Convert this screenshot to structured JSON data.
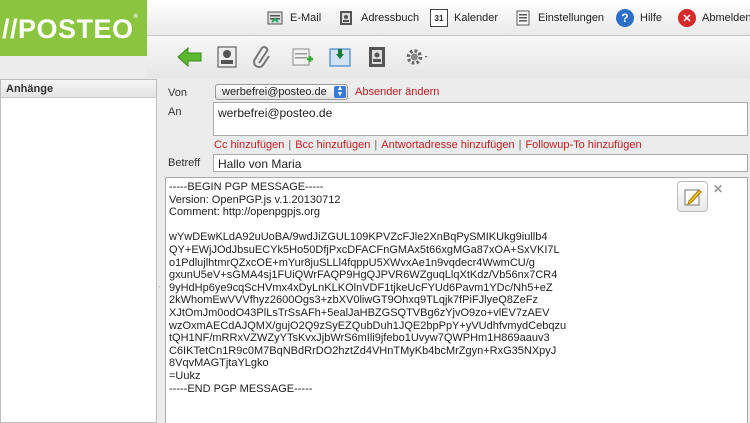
{
  "logo": {
    "text": "//POSTEO",
    "reg": "®"
  },
  "nav": [
    {
      "label": "E-Mail",
      "icon": "email-icon"
    },
    {
      "label": "Adressbuch",
      "icon": "addressbook-icon"
    },
    {
      "label": "Kalender",
      "icon": "calendar-icon",
      "badge": "31"
    },
    {
      "label": "Einstellungen",
      "icon": "settings-icon"
    },
    {
      "label": "Hilfe",
      "icon": "help-icon"
    },
    {
      "label": "Abmelden",
      "icon": "logout-icon"
    }
  ],
  "toolbar": [
    "back-arrow-icon",
    "address-card-icon",
    "paperclip-icon",
    "signature-icon",
    "save-draft-icon",
    "addressbook-icon",
    "gear-icon"
  ],
  "sidebar": {
    "title": "Anhänge"
  },
  "compose": {
    "from_label": "Von",
    "from_value": "werbefrei@posteo.de",
    "change_sender": "Absender ändern",
    "to_label": "An",
    "to_value": "werbefrei@posteo.de",
    "links": [
      "Cc hinzufügen",
      "Bcc hinzufügen",
      "Antwortadresse hinzufügen",
      "Followup-To hinzufügen"
    ],
    "subject_label": "Betreff",
    "subject_value": "Hallo von Maria",
    "body": "-----BEGIN PGP MESSAGE-----\nVersion: OpenPGP.js v.1.20130712\nComment: http://openpgpjs.org\n\nwYwDEwKLdA92uUoBA/9wdJiZGUL109KPVZcFJle2XnBqPySMIKUkg9iullb4\nQY+EWjJOdJbsuECYk5Ho50DfjPxcDFACFnGMAx5t66xgMGa87xOA+SxVKI7L\no1PdlujlhtmrQZxcOE+mYur8juSLLl4fqppU5XWvxAe1n9vqdecr4WwmCU/g\ngxunU5eV+sGMA4sj1FUiQWrFAQP9HgQJPVR6WZguqLlqXtKdz/Vb56nx7CR4\n9yHdHp6ye9cqScHVmx4xDyLnKLKOlnVDF1tjkeUcFYUd6Pavm1YDc/Nh5+eZ\n2kWhomEwVVVfhyz2600Ogs3+zbXV0liwGT9Ohxq9TLqjk7fPiFJlyeQ8ZeFz\nXJtOmJm0odO43PlLsTrSsAFh+5ealJaHBZGSQTVBg6zYjvO9zo+vlEV7zAEV\nwzOxmAECdAJQMX/gujO2Q9zSyEZQubDuh1JQE2bpPpY+yVUdhfvmydCebqzu\ntQH1NF/mRRxVZWZyYTsKvxJjbWrS6mIli9jfebo1Uvyw7QWPHm1H869aauv3\nC6IKTetCn1R9c0M7BqNBdRrDO2hztZd4VHnTMyKb4bcMrZgyn+RxG35NXpyJ\n8VqvMAGTjtaYLgko\n=Uukz\n-----END PGP MESSAGE-----"
  },
  "colors": {
    "brand": "#8bc53f",
    "link": "#c02020"
  }
}
